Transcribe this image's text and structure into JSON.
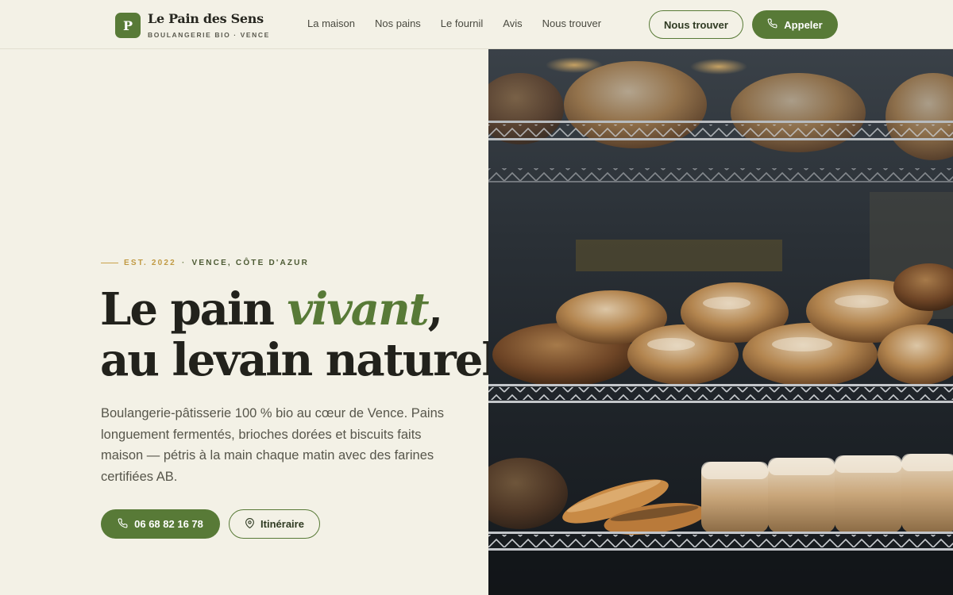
{
  "brand": {
    "mark": "P",
    "name": "Le Pain des Sens",
    "tagline": "BOULANGERIE BIO · VENCE"
  },
  "nav": {
    "items": [
      "La maison",
      "Nos pains",
      "Le fournil",
      "Avis",
      "Nous trouver"
    ]
  },
  "header_actions": {
    "find_label": "Nous trouver",
    "call_label": "Appeler"
  },
  "hero": {
    "eyebrow_est": "EST. 2022",
    "eyebrow_sep": "·",
    "eyebrow_location": "VENCE, CÔTE D'AZUR",
    "headline_part1": "Le pain ",
    "headline_accent": "vivant",
    "headline_part2": ",",
    "headline_line2": "au levain naturel.",
    "lede": "Boulangerie-pâtisserie 100 % bio au cœur de Vence. Pains longuement fermentés, brioches dorées et biscuits faits maison — pétris à la main chaque matin avec des farines certifiées AB.",
    "phone_label": "06 68 82 16 78",
    "route_label": "Itinéraire"
  },
  "icons": {
    "phone": "phone-icon",
    "pin": "map-pin-icon"
  },
  "colors": {
    "background": "#f3f1e6",
    "accent": "#587a37",
    "gold": "#c19a43",
    "text": "#22221c"
  }
}
